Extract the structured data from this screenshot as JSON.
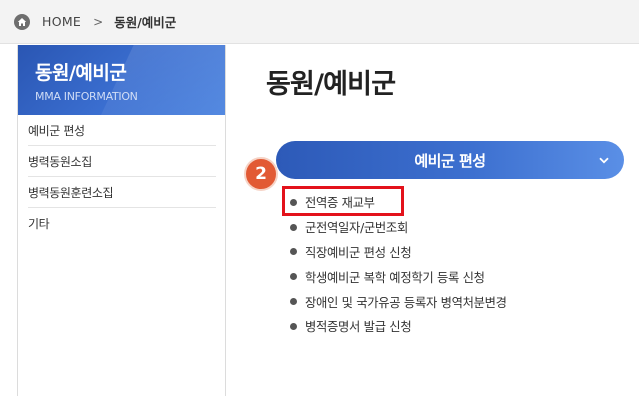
{
  "breadcrumb": {
    "home": "HOME",
    "separator": ">",
    "current": "동원/예비군"
  },
  "sidebar": {
    "title": "동원/예비군",
    "subtitle": "MMA INFORMATION",
    "items": [
      {
        "label": "예비군 편성"
      },
      {
        "label": "병력동원소집"
      },
      {
        "label": "병력동원훈련소집"
      },
      {
        "label": "기타"
      }
    ]
  },
  "main": {
    "title": "동원/예비군",
    "section": {
      "label": "예비군 편성"
    },
    "step_badge": "2",
    "links": [
      {
        "label": "전역증 재교부"
      },
      {
        "label": "군전역일자/군번조회"
      },
      {
        "label": "직장예비군 편성 신청"
      },
      {
        "label": "학생예비군 복학 예정학기 등록 신청"
      },
      {
        "label": "장애인 및 국가유공 등록자 병역처분변경"
      },
      {
        "label": "병적증명서 발급 신청"
      }
    ],
    "highlighted_link_index": 0
  },
  "colors": {
    "brand_blue": "#2d5ab8",
    "badge_orange": "#e25a34",
    "highlight_red": "#e3121b"
  },
  "icons": {
    "home": "home-icon",
    "accordion_toggle": "chevron-down-icon"
  }
}
